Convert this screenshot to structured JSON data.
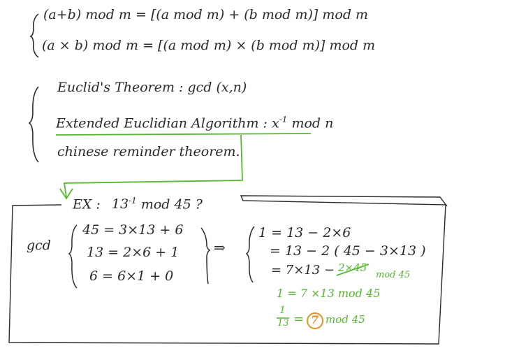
{
  "colors": {
    "ink": "#2a2a2a",
    "green": "#55b82e",
    "orange": "#e8901c"
  },
  "mod_rules": {
    "add": "(a+b) mod m = [(a mod m) + (b mod m)] mod m",
    "mul": "(a × b) mod m = [(a mod m) × (b mod m)] mod m"
  },
  "topics": {
    "euclid": "Euclid's Theorem : gcd (x,n)",
    "extended": "Extended Euclidian Algorithm : x",
    "extended_exp": "-1",
    "extended_tail": "mod n",
    "chinese": "chinese reminder theorem."
  },
  "example": {
    "label": "EX :",
    "question_base": "13",
    "question_exp": "-1",
    "question_tail": "mod 45 ?",
    "gcd_label": "gcd",
    "steps": [
      "45 = 3×13 + 6",
      "13 = 2×6 + 1",
      "6 = 6×1 + 0"
    ],
    "arrow": "⇒",
    "back": [
      "1 = 13 − 2×6",
      "= 13 − 2 ( 45 − 3×13 )",
      "= 7×13 −"
    ],
    "struck": "2×45",
    "mod_note": "mod 45",
    "result": "1 = 7 ×13  mod 45",
    "frac_num": "1",
    "frac_den": "13",
    "answer": "7",
    "answer_tail": "mod 45"
  }
}
